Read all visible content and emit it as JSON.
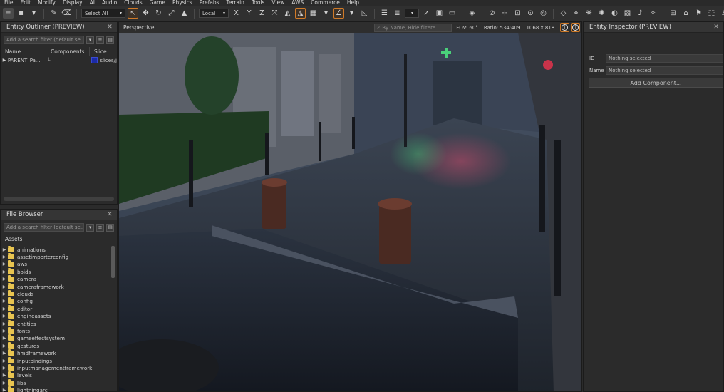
{
  "menubar": {
    "items": [
      "File",
      "Edit",
      "Modify",
      "Display",
      "AI",
      "Audio",
      "Clouds",
      "Game",
      "Physics",
      "Prefabs",
      "Terrain",
      "Tools",
      "View",
      "AWS",
      "Commerce",
      "Help"
    ]
  },
  "toolbar": {
    "select_label": "Select All",
    "space_label": "Local"
  },
  "outliner": {
    "title": "Entity Outliner (PREVIEW)",
    "filter_placeholder": "Add a search filter (default se...",
    "columns": [
      "Name",
      "Components",
      "Slice"
    ],
    "rows": [
      {
        "name": "PARENT_Pa...",
        "components": "└",
        "slice": "slices/j"
      }
    ]
  },
  "browser": {
    "title": "File Browser",
    "filter_placeholder": "Add a search filter (default se...",
    "root": "Assets",
    "folders": [
      "animations",
      "assetimporterconfig",
      "aws",
      "boids",
      "camera",
      "cameraframework",
      "clouds",
      "config",
      "editor",
      "engineassets",
      "entities",
      "fonts",
      "gameeffectsystem",
      "gestures",
      "hmdframework",
      "inputbindings",
      "inputmanagementframework",
      "levels",
      "libs",
      "lightningarc"
    ]
  },
  "viewport": {
    "title": "Perspective",
    "search_placeholder": "By Name, Hide filtere...",
    "fov": "FOV: 60°",
    "ratio": "Ratio: 534:409",
    "resolution": "1068 x 818",
    "info_glyph": "i",
    "help_glyph": "?"
  },
  "inspector": {
    "title": "Entity Inspector (PREVIEW)",
    "id_label": "ID",
    "id_value": "Nothing selected",
    "name_label": "Name",
    "name_value": "Nothing selected",
    "add_component": "Add Component..."
  },
  "icons": {
    "close": "✕",
    "collapsed_arrow": "▶",
    "dropdown": "▾"
  },
  "colors": {
    "accent": "#d07a28",
    "folder": "#e8c450",
    "slice": "#1c2ba6"
  }
}
